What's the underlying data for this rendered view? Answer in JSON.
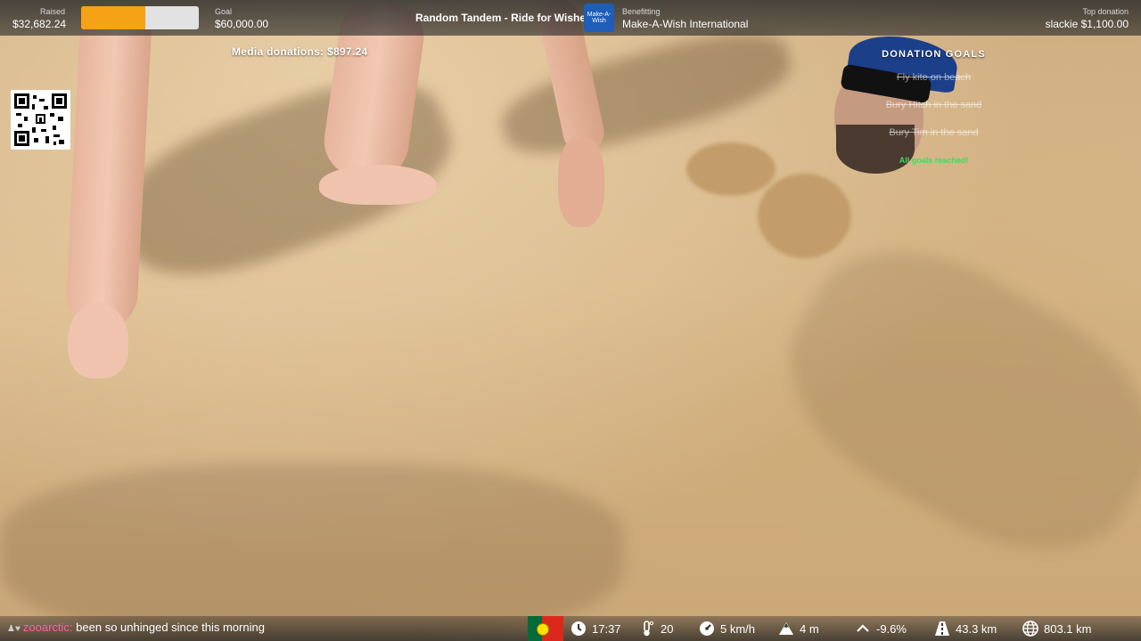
{
  "topbar": {
    "raised_label": "Raised",
    "raised_value": "$32,682.24",
    "progress_fraction": 0.545,
    "goal_label": "Goal",
    "goal_value": "$60,000.00",
    "event_title": "Random Tandem - Ride for Wishes",
    "logo_text": "Make-A-Wish",
    "benefitting_label": "Benefitting",
    "benefitting_value": "Make-A-Wish International",
    "top_donation_label": "Top donation",
    "top_donation_value": "slackie $1,100.00"
  },
  "media_donations": "Media donations: $897.24",
  "qr_icon": "qr-code-icon",
  "donation_goals": {
    "title": "DONATION GOALS",
    "items": [
      "Fly kite on beach",
      "Bury Hitch in the sand",
      "Bury Tim in the sand"
    ],
    "status": "All goals reached!"
  },
  "chat": {
    "username": "zooarctic:",
    "message": "been so unhinged since this morning"
  },
  "stats": {
    "time": "17:37",
    "temperature": "20",
    "speed": "5 km/h",
    "altitude": "4 m",
    "incline": "-9.6%",
    "distance": "43.3 km",
    "total_distance": "803.1 km"
  },
  "colors": {
    "progress_fill": "#f5a217",
    "goal_reached": "#3ddc5e",
    "chat_user": "#ff5fa8"
  }
}
